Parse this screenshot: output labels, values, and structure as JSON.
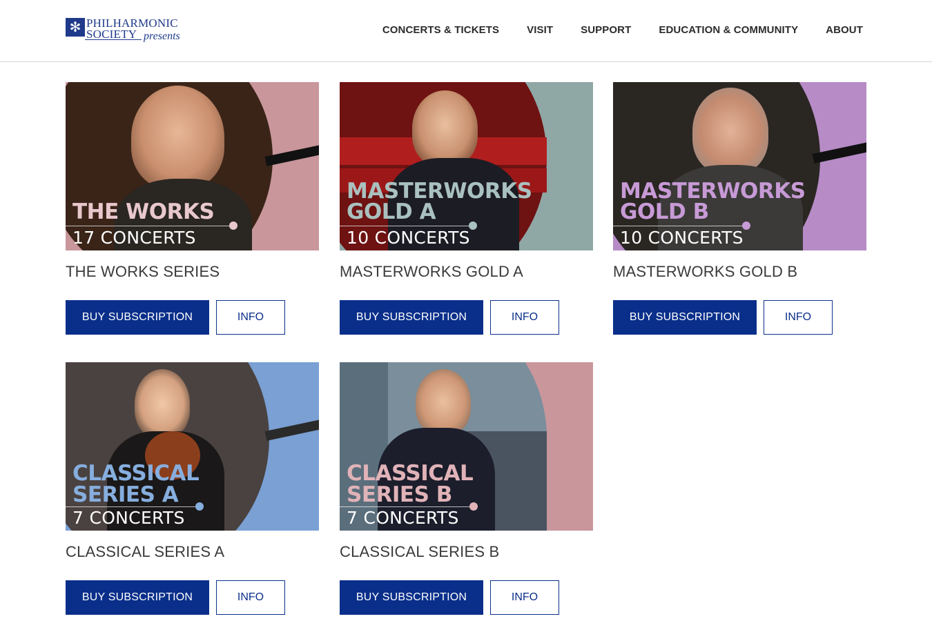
{
  "header": {
    "logo_line1": "PHILHARMONIC",
    "logo_line2": "SOCIETY",
    "logo_presents": "presents",
    "nav": [
      "CONCERTS & TICKETS",
      "VISIT",
      "SUPPORT",
      "EDUCATION & COMMUNITY",
      "ABOUT"
    ]
  },
  "cards": [
    {
      "image_title_line1": "THE WORKS",
      "image_title_line2": "",
      "image_concerts": "17 CONCERTS",
      "title": "THE WORKS SERIES",
      "buy_label": "BUY SUBSCRIPTION",
      "info_label": "INFO",
      "accent_color": "#c8969b",
      "title_color": "#e8c8cc"
    },
    {
      "image_title_line1": "MASTERWORKS",
      "image_title_line2": "GOLD A",
      "image_concerts": "10 CONCERTS",
      "title": "MASTERWORKS GOLD A",
      "buy_label": "BUY SUBSCRIPTION",
      "info_label": "INFO",
      "accent_color": "#8fa8a6",
      "title_color": "#a9c1bf"
    },
    {
      "image_title_line1": "MASTERWORKS",
      "image_title_line2": "GOLD B",
      "image_concerts": "10 CONCERTS",
      "title": "MASTERWORKS GOLD B",
      "buy_label": "BUY SUBSCRIPTION",
      "info_label": "INFO",
      "accent_color": "#b68bc6",
      "title_color": "#c79ad6"
    },
    {
      "image_title_line1": "CLASSICAL",
      "image_title_line2": "SERIES A",
      "image_concerts": "7 CONCERTS",
      "title": "CLASSICAL SERIES A",
      "buy_label": "BUY SUBSCRIPTION",
      "info_label": "INFO",
      "accent_color": "#7aa0d4",
      "title_color": "#86aede"
    },
    {
      "image_title_line1": "CLASSICAL",
      "image_title_line2": "SERIES B",
      "image_concerts": "7 CONCERTS",
      "title": "CLASSICAL SERIES B",
      "buy_label": "BUY SUBSCRIPTION",
      "info_label": "INFO",
      "accent_color": "#c8969b",
      "title_color": "#e0b3b8"
    }
  ],
  "colors": {
    "brand_blue": "#0a2f8a",
    "logo_blue": "#1f3a8a"
  }
}
